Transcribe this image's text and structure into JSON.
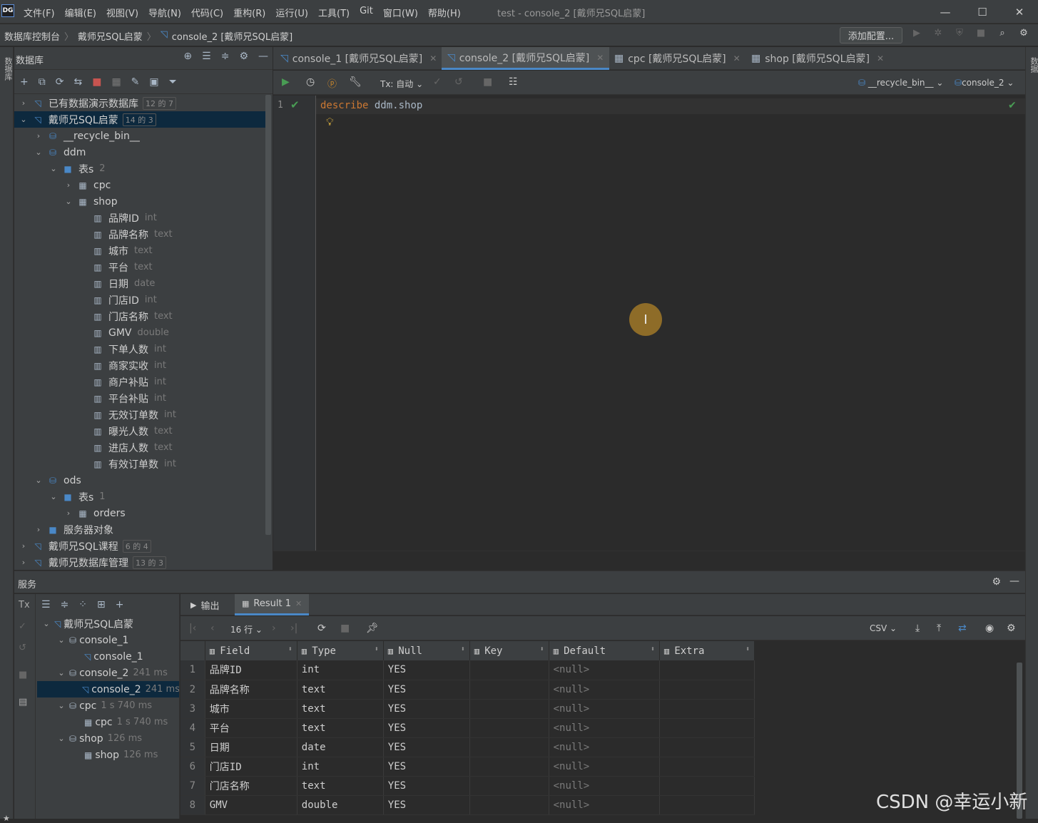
{
  "app": {
    "logo": "DG",
    "window_title": "test - console_2 [戴师兄SQL启蒙]"
  },
  "menu": [
    "文件(F)",
    "编辑(E)",
    "视图(V)",
    "导航(N)",
    "代码(C)",
    "重构(R)",
    "运行(U)",
    "工具(T)",
    "Git",
    "窗口(W)",
    "帮助(H)"
  ],
  "breadcrumbs": [
    "数据库控制台",
    "戴师兄SQL启蒙",
    "console_2 [戴师兄SQL启蒙]"
  ],
  "nav": {
    "add_config": "添加配置..."
  },
  "left_stripe": {
    "label": "数据库"
  },
  "right_stripe": {
    "label": "数据"
  },
  "db_panel": {
    "title": "数据库",
    "tree": [
      {
        "label": "已有数据演示数据库",
        "badge": "12 的 7",
        "level": 0,
        "arrow": "›",
        "icon": "db"
      },
      {
        "label": "戴师兄SQL启蒙",
        "badge": "14 的 3",
        "level": 0,
        "arrow": "⌄",
        "icon": "db",
        "selected": true
      },
      {
        "label": "__recycle_bin__",
        "level": 1,
        "arrow": "›",
        "icon": "schema"
      },
      {
        "label": "ddm",
        "level": 1,
        "arrow": "⌄",
        "icon": "schema"
      },
      {
        "label": "表s",
        "sub": "2",
        "level": 2,
        "arrow": "⌄",
        "icon": "folder"
      },
      {
        "label": "cpc",
        "level": 3,
        "arrow": "›",
        "icon": "table"
      },
      {
        "label": "shop",
        "level": 3,
        "arrow": "⌄",
        "icon": "table"
      },
      {
        "label": "品牌ID",
        "sub": "int",
        "level": 4,
        "icon": "col"
      },
      {
        "label": "品牌名称",
        "sub": "text",
        "level": 4,
        "icon": "col"
      },
      {
        "label": "城市",
        "sub": "text",
        "level": 4,
        "icon": "col"
      },
      {
        "label": "平台",
        "sub": "text",
        "level": 4,
        "icon": "col"
      },
      {
        "label": "日期",
        "sub": "date",
        "level": 4,
        "icon": "col"
      },
      {
        "label": "门店ID",
        "sub": "int",
        "level": 4,
        "icon": "col"
      },
      {
        "label": "门店名称",
        "sub": "text",
        "level": 4,
        "icon": "col"
      },
      {
        "label": "GMV",
        "sub": "double",
        "level": 4,
        "icon": "col"
      },
      {
        "label": "下单人数",
        "sub": "int",
        "level": 4,
        "icon": "col"
      },
      {
        "label": "商家实收",
        "sub": "int",
        "level": 4,
        "icon": "col"
      },
      {
        "label": "商户补贴",
        "sub": "int",
        "level": 4,
        "icon": "col"
      },
      {
        "label": "平台补贴",
        "sub": "int",
        "level": 4,
        "icon": "col"
      },
      {
        "label": "无效订单数",
        "sub": "int",
        "level": 4,
        "icon": "col"
      },
      {
        "label": "曝光人数",
        "sub": "text",
        "level": 4,
        "icon": "col"
      },
      {
        "label": "进店人数",
        "sub": "text",
        "level": 4,
        "icon": "col"
      },
      {
        "label": "有效订单数",
        "sub": "int",
        "level": 4,
        "icon": "col"
      },
      {
        "label": "ods",
        "level": 1,
        "arrow": "⌄",
        "icon": "schema"
      },
      {
        "label": "表s",
        "sub": "1",
        "level": 2,
        "arrow": "⌄",
        "icon": "folder"
      },
      {
        "label": "orders",
        "level": 3,
        "arrow": "›",
        "icon": "table"
      },
      {
        "label": "服务器对象",
        "level": 1,
        "arrow": "›",
        "icon": "folder"
      },
      {
        "label": "戴师兄SQL课程",
        "badge": "6 的 4",
        "level": 0,
        "arrow": "›",
        "icon": "db"
      },
      {
        "label": "戴师兄数据库管理",
        "badge": "13 的 3",
        "level": 0,
        "arrow": "›",
        "icon": "db"
      }
    ]
  },
  "editor": {
    "tabs": [
      {
        "label": "console_1 [戴师兄SQL启蒙]",
        "icon": "console"
      },
      {
        "label": "console_2 [戴师兄SQL启蒙]",
        "icon": "console",
        "active": true
      },
      {
        "label": "cpc [戴师兄SQL启蒙]",
        "icon": "table"
      },
      {
        "label": "shop [戴师兄SQL启蒙]",
        "icon": "table"
      }
    ],
    "tx_mode": "Tx: 自动",
    "schema_select": "__recycle_bin__",
    "session_select": "console_2",
    "line_number": "1",
    "code_keyword": "describe",
    "code_rest": " ddm.shop"
  },
  "services": {
    "title": "服务",
    "tree": [
      {
        "label": "戴师兄SQL启蒙",
        "level": 0,
        "arrow": "⌄"
      },
      {
        "label": "console_1",
        "level": 1,
        "arrow": "⌄"
      },
      {
        "label": "console_1",
        "level": 2
      },
      {
        "label": "console_2",
        "sub": "241 ms",
        "level": 1,
        "arrow": "⌄"
      },
      {
        "label": "console_2",
        "sub": "241 ms",
        "level": 2,
        "selected": true
      },
      {
        "label": "cpc",
        "sub": "1 s 740 ms",
        "level": 1,
        "arrow": "⌄"
      },
      {
        "label": "cpc",
        "sub": "1 s 740 ms",
        "level": 2
      },
      {
        "label": "shop",
        "sub": "126 ms",
        "level": 1,
        "arrow": "⌄"
      },
      {
        "label": "shop",
        "sub": "126 ms",
        "level": 2
      }
    ]
  },
  "results": {
    "tabs": [
      {
        "label": "输出"
      },
      {
        "label": "Result 1",
        "active": true
      }
    ],
    "row_count": "16 行",
    "export_format": "CSV",
    "columns": [
      "Field",
      "Type",
      "Null",
      "Key",
      "Default",
      "Extra"
    ],
    "rows": [
      [
        "1",
        "品牌ID",
        "int",
        "YES",
        "",
        "<null>",
        ""
      ],
      [
        "2",
        "品牌名称",
        "text",
        "YES",
        "",
        "<null>",
        ""
      ],
      [
        "3",
        "城市",
        "text",
        "YES",
        "",
        "<null>",
        ""
      ],
      [
        "4",
        "平台",
        "text",
        "YES",
        "",
        "<null>",
        ""
      ],
      [
        "5",
        "日期",
        "date",
        "YES",
        "",
        "<null>",
        ""
      ],
      [
        "6",
        "门店ID",
        "int",
        "YES",
        "",
        "<null>",
        ""
      ],
      [
        "7",
        "门店名称",
        "text",
        "YES",
        "",
        "<null>",
        ""
      ],
      [
        "8",
        "GMV",
        "double",
        "YES",
        "",
        "<null>",
        ""
      ]
    ]
  },
  "watermark": "CSDN @幸运小新",
  "colors": {
    "accent": "#4a88c7",
    "keyword": "#cc7832",
    "run_green": "#499c54",
    "stop_red": "#c75450"
  }
}
